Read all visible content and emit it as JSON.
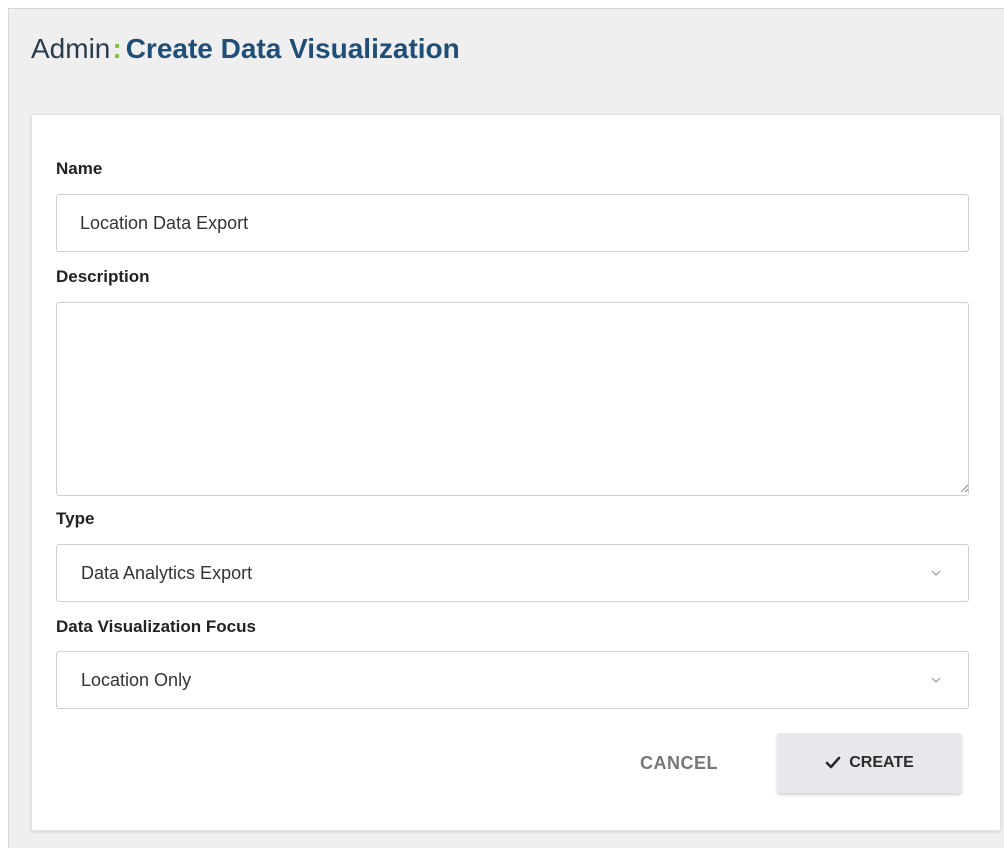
{
  "header": {
    "prefix": "Admin",
    "separator": ":",
    "title": "Create Data Visualization"
  },
  "form": {
    "name": {
      "label": "Name",
      "value": "Location Data Export",
      "placeholder": ""
    },
    "description": {
      "label": "Description",
      "value": "",
      "placeholder": ""
    },
    "type": {
      "label": "Type",
      "selected": "Data Analytics Export"
    },
    "focus": {
      "label": "Data Visualization Focus",
      "selected": "Location Only"
    }
  },
  "actions": {
    "cancel_label": "CANCEL",
    "create_label": "CREATE"
  },
  "icons": {
    "type_chevron": "chevron-down-icon",
    "focus_chevron": "chevron-down-icon",
    "create": "check-icon"
  },
  "colors": {
    "title_blue": "#1f4e79",
    "separator_green": "#7fc43a",
    "create_button_bg": "#e6e8eb"
  }
}
